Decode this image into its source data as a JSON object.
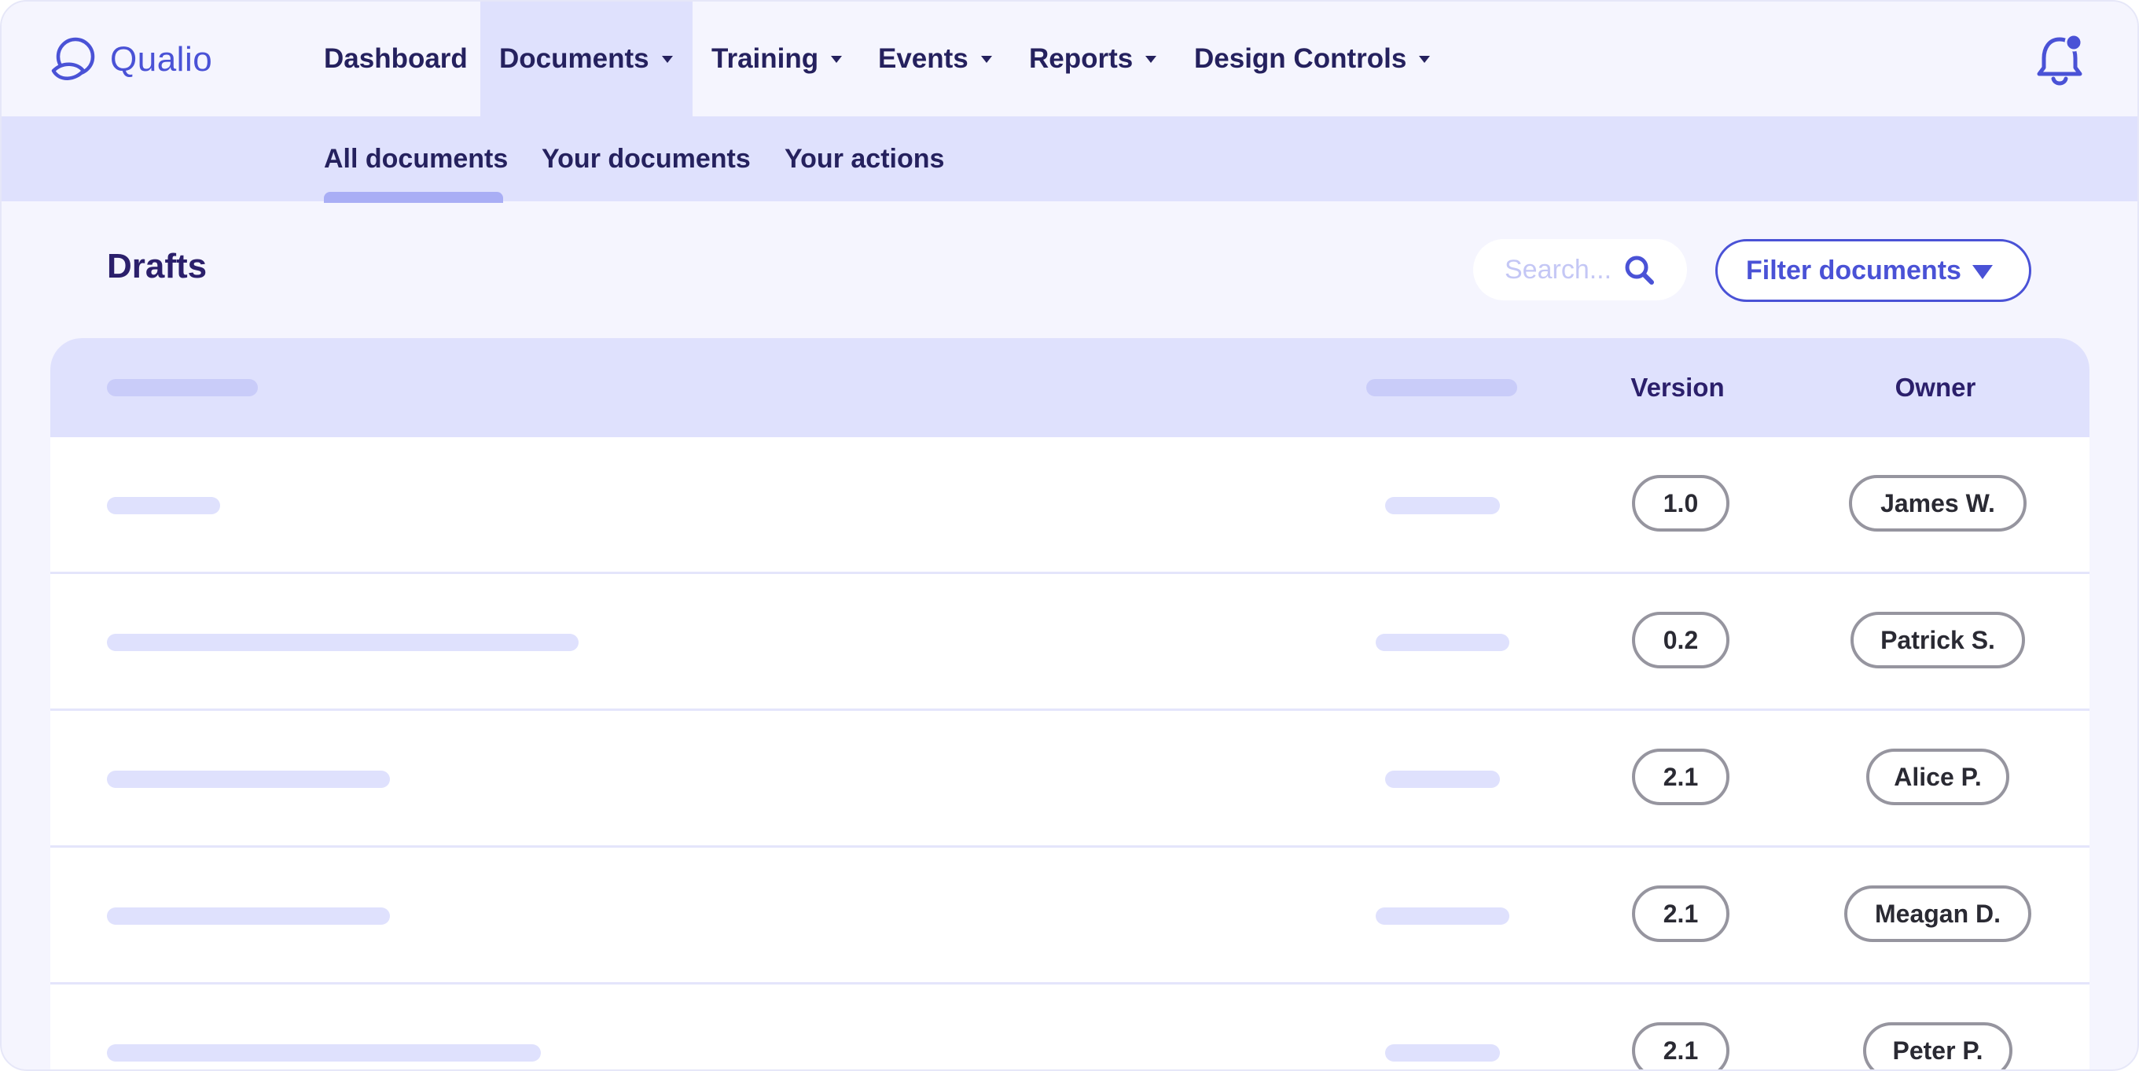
{
  "app": {
    "name": "Qualio"
  },
  "nav": {
    "items": [
      {
        "label": "Dashboard",
        "has_dropdown": false,
        "active": false
      },
      {
        "label": "Documents",
        "has_dropdown": true,
        "active": true
      },
      {
        "label": "Training",
        "has_dropdown": true,
        "active": false
      },
      {
        "label": "Events",
        "has_dropdown": true,
        "active": false
      },
      {
        "label": "Reports",
        "has_dropdown": true,
        "active": false
      },
      {
        "label": "Design Controls",
        "has_dropdown": true,
        "active": false
      }
    ],
    "notification_icon": "bell-icon",
    "has_unread_notifications": true
  },
  "subnav": {
    "tabs": [
      {
        "label": "All documents",
        "active": true
      },
      {
        "label": "Your documents",
        "active": false
      },
      {
        "label": "Your actions",
        "active": false
      }
    ]
  },
  "toolbar": {
    "title": "Drafts",
    "search_placeholder": "Search...",
    "search_icon": "search-icon",
    "filter_label": "Filter documents",
    "filter_icon": "triangle-down-icon"
  },
  "table": {
    "columns": [
      "",
      "",
      "Version",
      "Owner"
    ],
    "rows": [
      {
        "version": "1.0",
        "owner": "James W."
      },
      {
        "version": "0.2",
        "owner": "Patrick S."
      },
      {
        "version": "2.1",
        "owner": "Alice P."
      },
      {
        "version": "2.1",
        "owner": "Meagan D."
      },
      {
        "version": "2.1",
        "owner": "Peter P."
      }
    ]
  },
  "colors": {
    "accent": "#4a52d6",
    "nav_text": "#25215e",
    "active_tab_bg": "#dfe1fd",
    "page_bg": "#f5f5fe",
    "skeleton": "#dfe1fd",
    "pill_border": "#96959f"
  }
}
